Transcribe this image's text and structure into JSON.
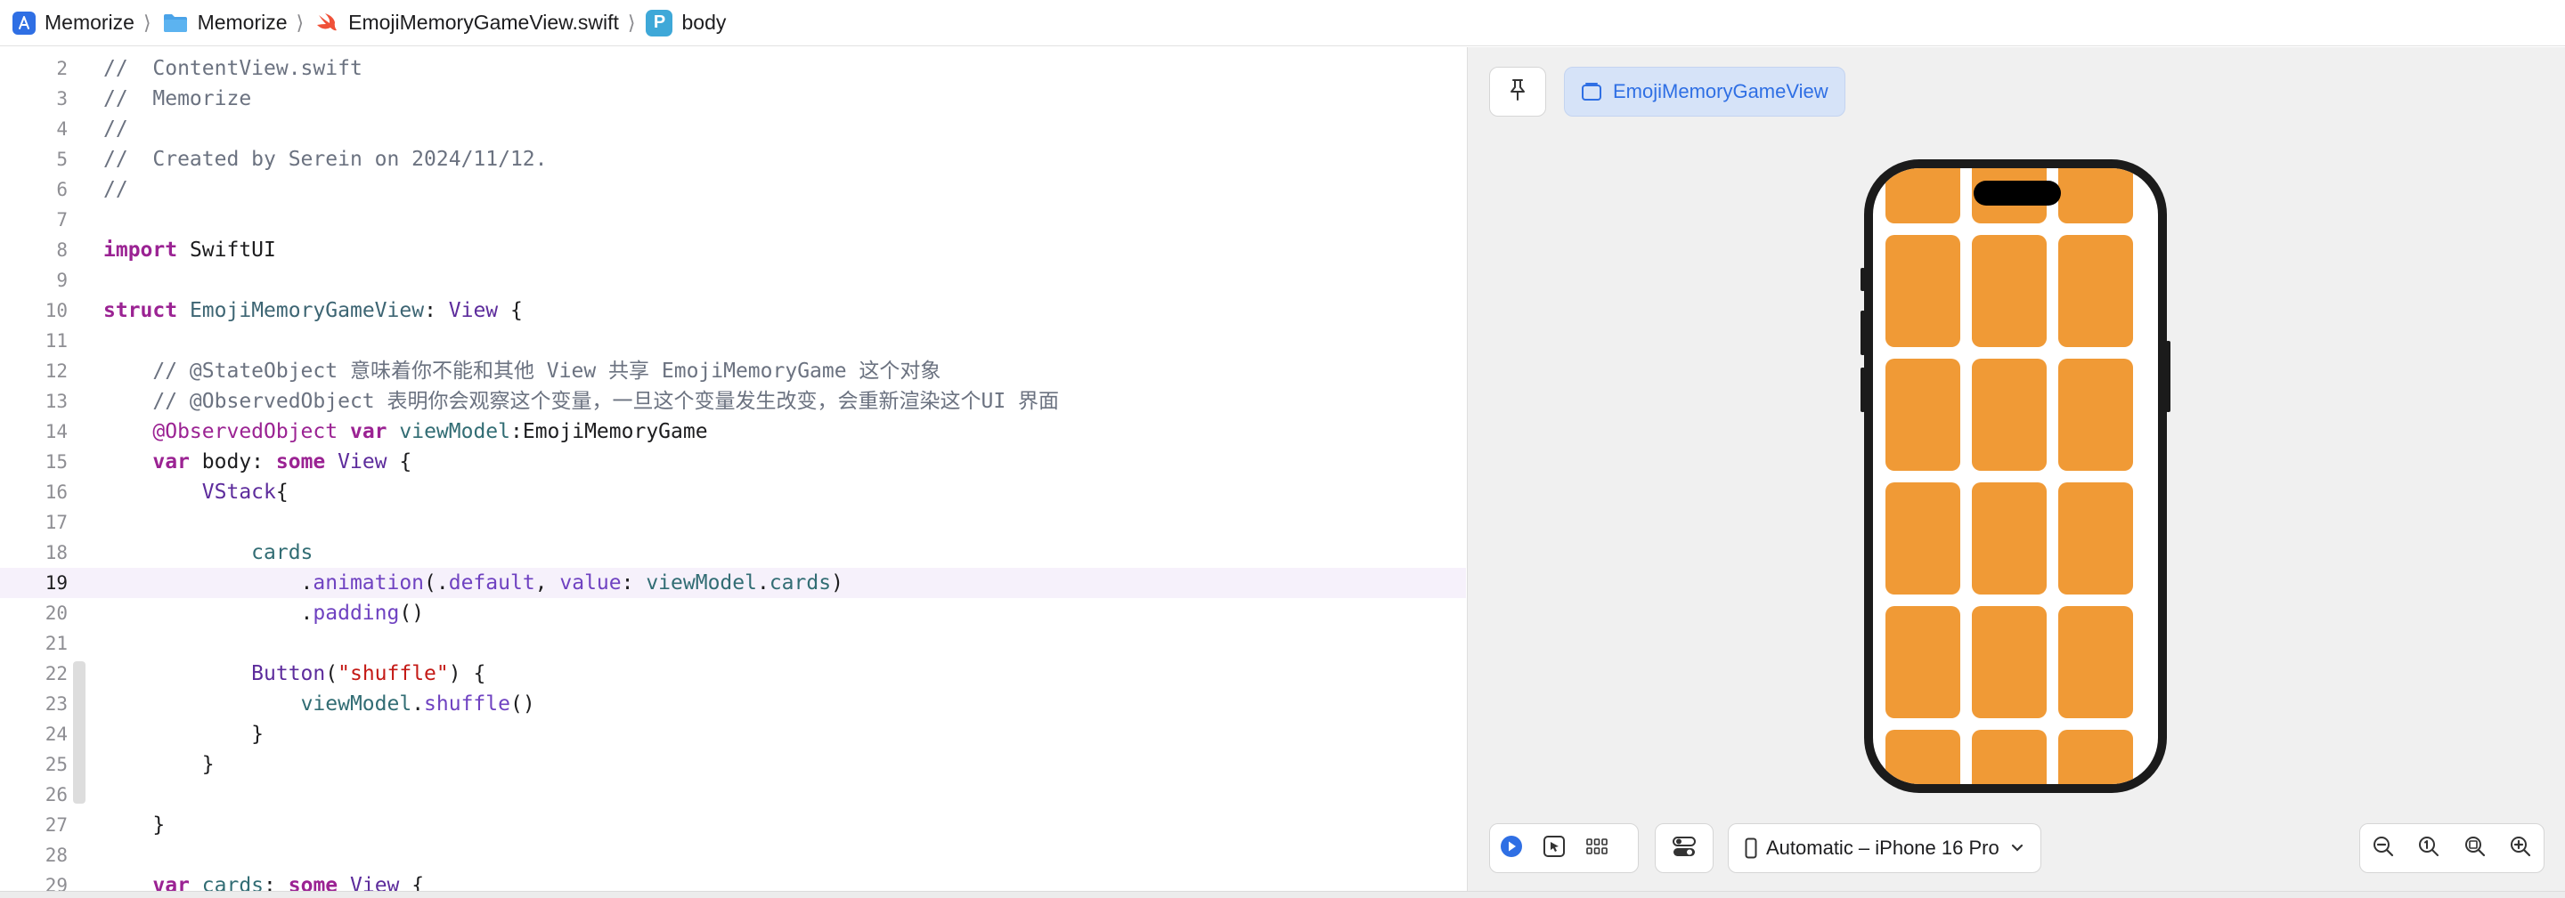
{
  "breadcrumb": {
    "items": [
      {
        "label": "Memorize",
        "icon": "app-icon"
      },
      {
        "label": "Memorize",
        "icon": "folder-icon"
      },
      {
        "label": "EmojiMemoryGameView.swift",
        "icon": "swift-file-icon"
      },
      {
        "label": "body",
        "icon": "property-icon",
        "badge": "P"
      }
    ]
  },
  "editor": {
    "current_line": 19,
    "lines": [
      {
        "num": "2",
        "tokens": [
          {
            "t": "//  ContentView.swift",
            "c": "comment"
          }
        ]
      },
      {
        "num": "3",
        "tokens": [
          {
            "t": "//  Memorize",
            "c": "comment"
          }
        ]
      },
      {
        "num": "4",
        "tokens": [
          {
            "t": "//",
            "c": "comment"
          }
        ]
      },
      {
        "num": "5",
        "tokens": [
          {
            "t": "//  Created by Serein on 2024/11/12.",
            "c": "comment"
          }
        ]
      },
      {
        "num": "6",
        "tokens": [
          {
            "t": "//",
            "c": "comment"
          }
        ]
      },
      {
        "num": "7",
        "tokens": []
      },
      {
        "num": "8",
        "tokens": [
          {
            "t": "import",
            "c": "kw"
          },
          {
            "t": " SwiftUI",
            "c": "plain"
          }
        ]
      },
      {
        "num": "9",
        "tokens": []
      },
      {
        "num": "10",
        "tokens": [
          {
            "t": "struct",
            "c": "kw"
          },
          {
            "t": " ",
            "c": "plain"
          },
          {
            "t": "EmojiMemoryGameView",
            "c": "type"
          },
          {
            "t": ": ",
            "c": "plain"
          },
          {
            "t": "View",
            "c": "ptype"
          },
          {
            "t": " {",
            "c": "plain"
          }
        ]
      },
      {
        "num": "11",
        "tokens": []
      },
      {
        "num": "12",
        "tokens": [
          {
            "t": "    // @StateObject 意味着你不能和其他 View 共享 EmojiMemoryGame 这个对象",
            "c": "comment"
          }
        ]
      },
      {
        "num": "13",
        "tokens": [
          {
            "t": "    // @ObservedObject 表明你会观察这个变量，一旦这个变量发生改变，会重新渲染这个UI 界面",
            "c": "comment"
          }
        ]
      },
      {
        "num": "14",
        "tokens": [
          {
            "t": "    ",
            "c": "plain"
          },
          {
            "t": "@ObservedObject",
            "c": "attr"
          },
          {
            "t": " ",
            "c": "plain"
          },
          {
            "t": "var",
            "c": "kw"
          },
          {
            "t": " ",
            "c": "plain"
          },
          {
            "t": "viewModel",
            "c": "prop"
          },
          {
            "t": ":EmojiMemoryGame",
            "c": "plain"
          }
        ]
      },
      {
        "num": "15",
        "tokens": [
          {
            "t": "    ",
            "c": "plain"
          },
          {
            "t": "var",
            "c": "kw"
          },
          {
            "t": " body: ",
            "c": "plain"
          },
          {
            "t": "some",
            "c": "kw"
          },
          {
            "t": " ",
            "c": "plain"
          },
          {
            "t": "View",
            "c": "ptype"
          },
          {
            "t": " {",
            "c": "plain"
          }
        ]
      },
      {
        "num": "16",
        "tokens": [
          {
            "t": "        ",
            "c": "plain"
          },
          {
            "t": "VStack",
            "c": "ptype"
          },
          {
            "t": "{",
            "c": "plain"
          }
        ]
      },
      {
        "num": "17",
        "tokens": []
      },
      {
        "num": "18",
        "tokens": [
          {
            "t": "            ",
            "c": "plain"
          },
          {
            "t": "cards",
            "c": "prop"
          }
        ]
      },
      {
        "num": "19",
        "tokens": [
          {
            "t": "                .",
            "c": "plain"
          },
          {
            "t": "animation",
            "c": "func"
          },
          {
            "t": "(.",
            "c": "plain"
          },
          {
            "t": "default",
            "c": "func"
          },
          {
            "t": ", ",
            "c": "plain"
          },
          {
            "t": "value",
            "c": "func"
          },
          {
            "t": ": ",
            "c": "plain"
          },
          {
            "t": "viewModel",
            "c": "prop"
          },
          {
            "t": ".",
            "c": "plain"
          },
          {
            "t": "cards",
            "c": "prop"
          },
          {
            "t": ")",
            "c": "plain"
          }
        ]
      },
      {
        "num": "20",
        "tokens": [
          {
            "t": "                .",
            "c": "plain"
          },
          {
            "t": "padding",
            "c": "func"
          },
          {
            "t": "()",
            "c": "plain"
          }
        ]
      },
      {
        "num": "21",
        "tokens": []
      },
      {
        "num": "22",
        "tokens": [
          {
            "t": "            ",
            "c": "plain"
          },
          {
            "t": "Button",
            "c": "ptype"
          },
          {
            "t": "(",
            "c": "plain"
          },
          {
            "t": "\"shuffle\"",
            "c": "str"
          },
          {
            "t": ") {",
            "c": "plain"
          }
        ]
      },
      {
        "num": "23",
        "tokens": [
          {
            "t": "                ",
            "c": "plain"
          },
          {
            "t": "viewModel",
            "c": "prop"
          },
          {
            "t": ".",
            "c": "plain"
          },
          {
            "t": "shuffle",
            "c": "func"
          },
          {
            "t": "()",
            "c": "plain"
          }
        ]
      },
      {
        "num": "24",
        "tokens": [
          {
            "t": "            }",
            "c": "plain"
          }
        ]
      },
      {
        "num": "25",
        "tokens": [
          {
            "t": "        }",
            "c": "plain"
          }
        ]
      },
      {
        "num": "26",
        "tokens": []
      },
      {
        "num": "27",
        "tokens": [
          {
            "t": "    }",
            "c": "plain"
          }
        ]
      },
      {
        "num": "28",
        "tokens": []
      },
      {
        "num": "29",
        "tokens": [
          {
            "t": "    ",
            "c": "plain"
          },
          {
            "t": "var",
            "c": "kw"
          },
          {
            "t": " ",
            "c": "plain"
          },
          {
            "t": "cards",
            "c": "prop"
          },
          {
            "t": ": ",
            "c": "plain"
          },
          {
            "t": "some",
            "c": "kw"
          },
          {
            "t": " ",
            "c": "plain"
          },
          {
            "t": "View",
            "c": "ptype"
          },
          {
            "t": " {",
            "c": "plain"
          }
        ]
      }
    ]
  },
  "preview": {
    "pin_icon": "pin-icon",
    "tab_label": "EmojiMemoryGameView",
    "device_label": "Automatic – iPhone 16 Pro",
    "card_color": "#f09a36",
    "grid_columns": 3,
    "grid_rows": 6,
    "toolbar": {
      "live_icon": "play-circle-icon",
      "select_icon": "cursor-select-icon",
      "variants_icon": "grid-variants-icon",
      "settings_icon": "toggle-settings-icon",
      "zoom_icons": [
        "zoom-out-icon",
        "zoom-actual-icon",
        "zoom-fit-icon",
        "zoom-in-icon"
      ]
    }
  },
  "colors": {
    "accent": "#2f6fe4",
    "keyword": "#9b2393",
    "comment": "#6b7280",
    "string": "#c41a16",
    "current_line": "#f6f1fb"
  }
}
